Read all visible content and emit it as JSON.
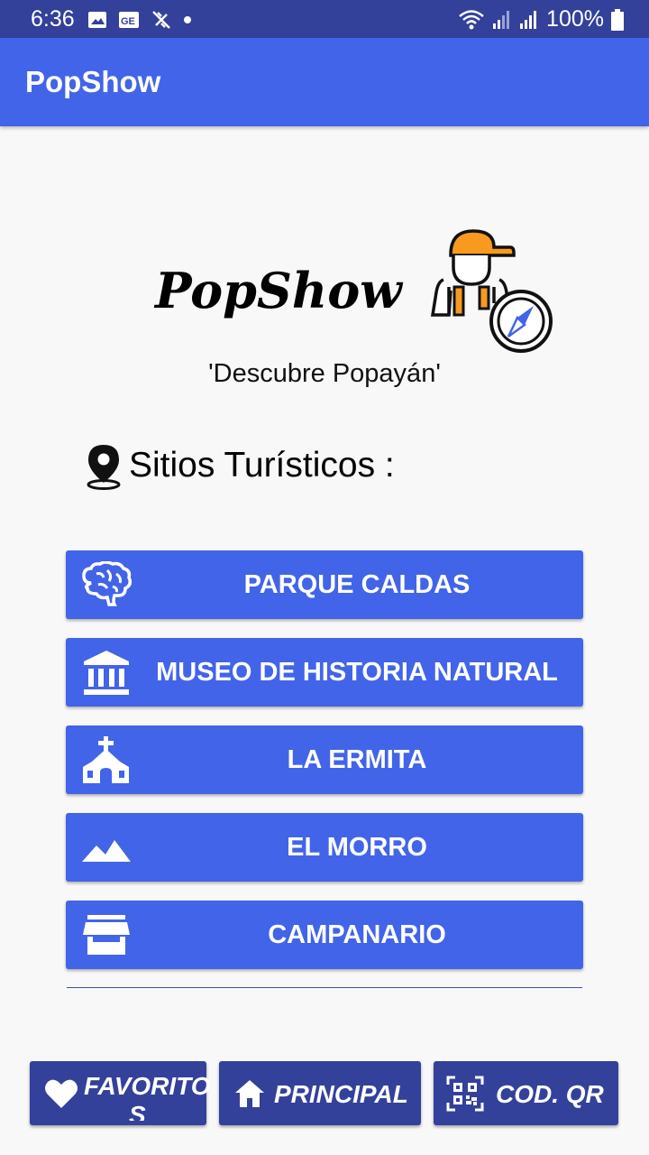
{
  "status_bar": {
    "time": "6:36",
    "battery": "100%"
  },
  "app_bar": {
    "title": "PopShow"
  },
  "logo": {
    "text": "PopShow",
    "tagline": "'Descubre Popayán'"
  },
  "section": {
    "title": "Sitios Turísticos :"
  },
  "sites": [
    {
      "label": "PARQUE CALDAS",
      "icon": "brain-icon"
    },
    {
      "label": "MUSEO DE HISTORIA NATURAL",
      "icon": "museum-icon"
    },
    {
      "label": "LA ERMITA",
      "icon": "church-icon"
    },
    {
      "label": "EL MORRO",
      "icon": "mountain-icon"
    },
    {
      "label": "CAMPANARIO",
      "icon": "store-icon"
    }
  ],
  "bottom_nav": {
    "favorites": {
      "label_line1": "FAVORITO",
      "label_line2": "S",
      "icon": "heart-icon"
    },
    "principal": {
      "label": "PRINCIPAL",
      "icon": "home-icon"
    },
    "qr": {
      "label": "COD. QR",
      "icon": "qr-code-icon"
    }
  },
  "colors": {
    "primary": "#4264e8",
    "primary_dark": "#33419a",
    "accent_orange": "#f79a1e",
    "background": "#f8f8f8"
  }
}
